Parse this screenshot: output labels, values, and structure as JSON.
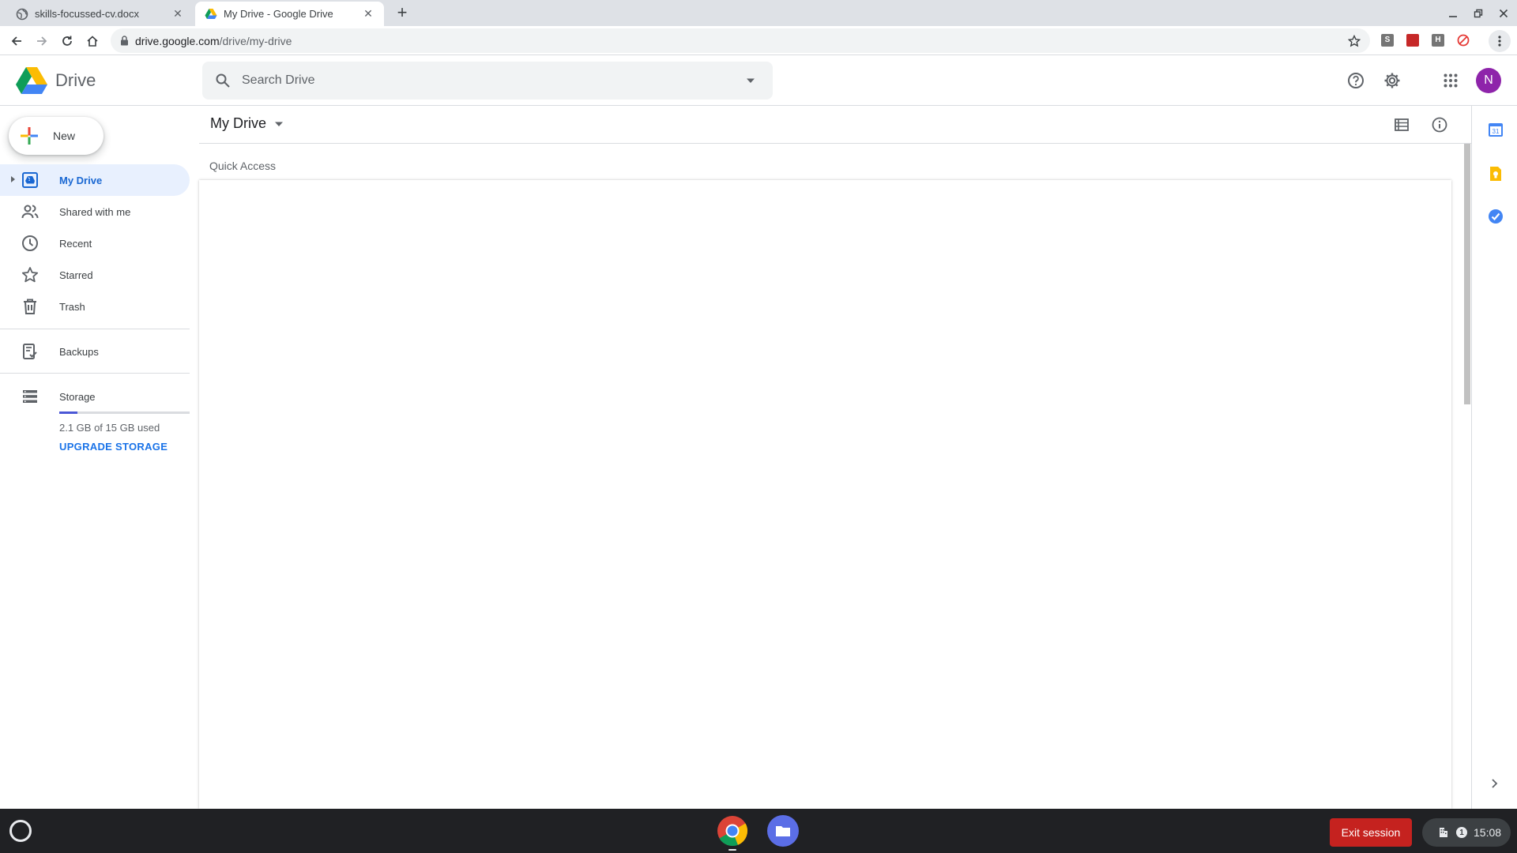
{
  "browser": {
    "tabs": [
      {
        "title": "skills-focussed-cv.docx",
        "close": "✕",
        "favicon": "globe-icon"
      },
      {
        "title": "My Drive - Google Drive",
        "close": "✕",
        "favicon": "drive-icon"
      }
    ],
    "new_tab": "+",
    "url_host": "drive.google.com",
    "url_path": "/drive/my-drive",
    "extensions": [
      "S",
      "H"
    ]
  },
  "header": {
    "app_name": "Drive",
    "search_placeholder": "Search Drive",
    "avatar_letter": "N"
  },
  "sidebar": {
    "new_label": "New",
    "items": [
      {
        "label": "My Drive",
        "icon": "my-drive-icon",
        "active": true
      },
      {
        "label": "Shared with me",
        "icon": "shared-icon"
      },
      {
        "label": "Recent",
        "icon": "clock-icon"
      },
      {
        "label": "Starred",
        "icon": "star-icon"
      },
      {
        "label": "Trash",
        "icon": "trash-icon"
      },
      {
        "label": "Backups",
        "icon": "backup-icon"
      },
      {
        "label": "Storage",
        "icon": "storage-icon"
      }
    ],
    "storage_used_fraction": 0.14,
    "storage_text": "2.1 GB of 15 GB used",
    "upgrade_label": "UPGRADE STORAGE"
  },
  "main": {
    "title": "My Drive",
    "quick_access": "Quick Access"
  },
  "side_panel": {
    "calendar_day": "31"
  },
  "shelf": {
    "exit_label": "Exit session",
    "notification_count": "1",
    "time": "15:08"
  },
  "colors": {
    "accent": "#1a73e8",
    "active_bg": "#e8f0fe",
    "exit_red": "#c5221f",
    "avatar": "#8e24aa"
  }
}
